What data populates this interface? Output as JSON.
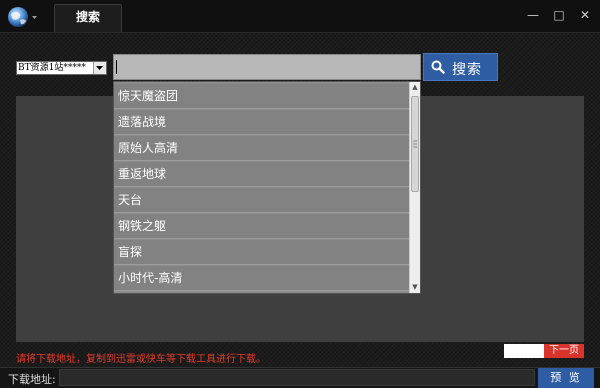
{
  "titlebar": {
    "tab_label": "搜索",
    "logo_icon": "globe-icon",
    "minimize_label": "—",
    "maximize_label": "□",
    "close_label": "✕"
  },
  "search": {
    "source_select_value": "BT资源1站*****",
    "input_value": "",
    "button_label": "搜索",
    "button_icon": "search-icon"
  },
  "dropdown": {
    "items": [
      "惊天魔盗团",
      "遗落战境",
      "原始人高清",
      "重返地球",
      "天台",
      "钢铁之躯",
      "盲探",
      "小时代-高清"
    ]
  },
  "notice": "请将下载地址，复制到迅雷或快车等下载工具进行下载。",
  "pagination": {
    "page_value": "",
    "next_label": "下一页"
  },
  "bottom": {
    "download_label": "下载地址:",
    "download_value": "",
    "preview_label": "预 览"
  },
  "colors": {
    "accent": "#2f5da3",
    "warning": "#e23a2a",
    "next_button": "#d9342b"
  }
}
